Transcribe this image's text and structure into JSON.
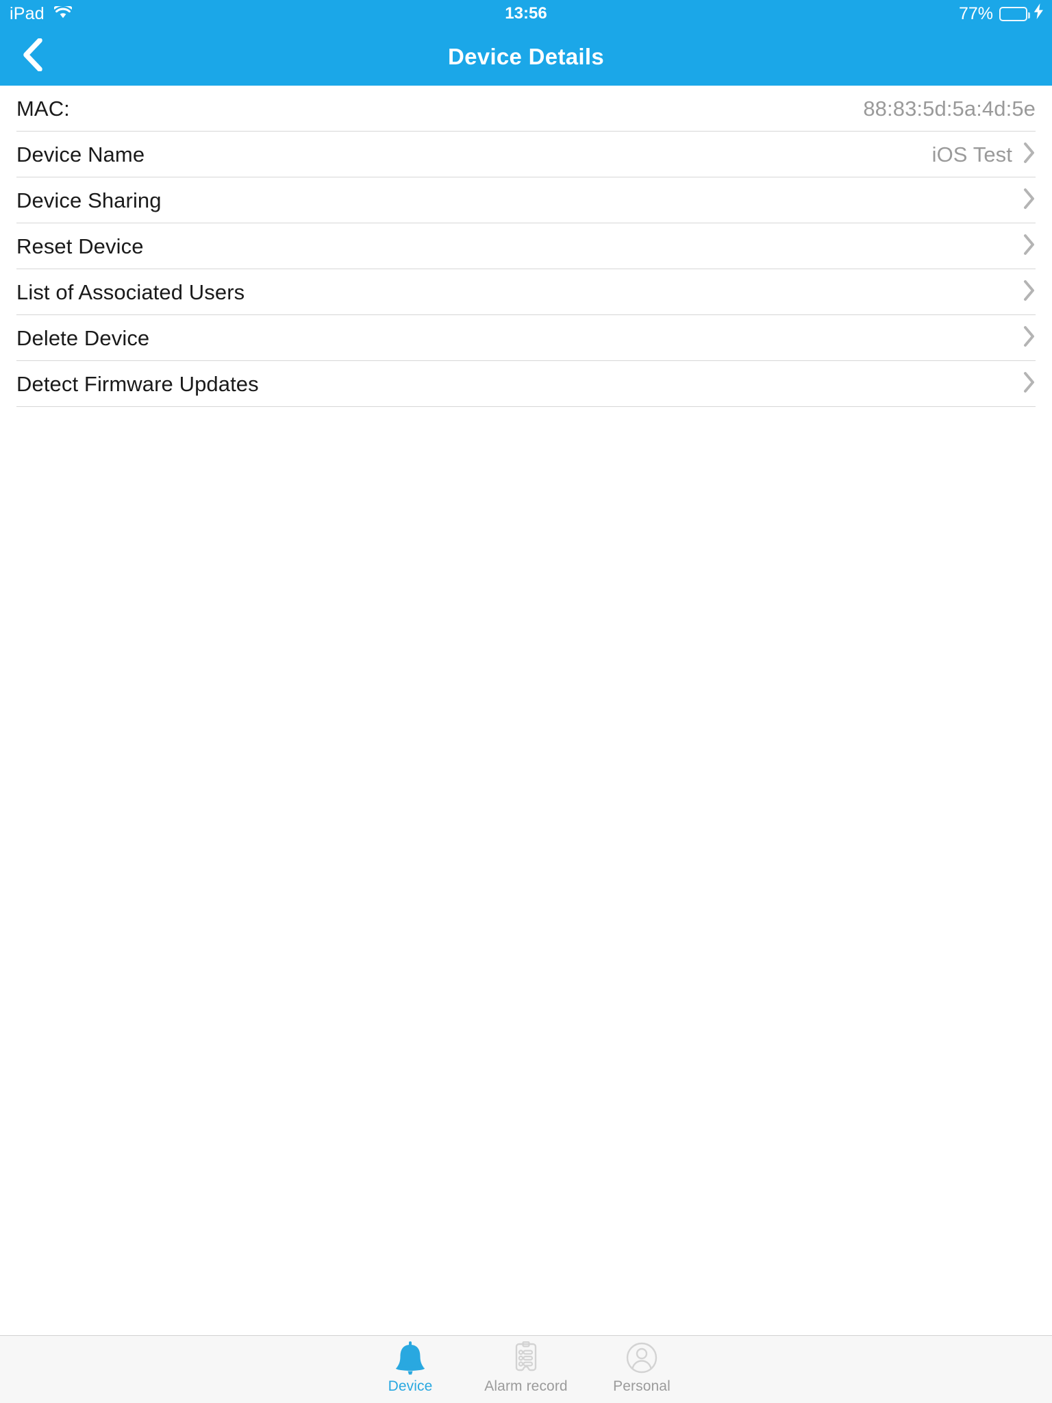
{
  "status_bar": {
    "device_label": "iPad",
    "wifi_icon": "wifi-icon",
    "time": "13:56",
    "battery_percent": "77%",
    "battery_level": 77,
    "battery_icon": "battery-icon",
    "charging_icon": "lightning-bolt-icon"
  },
  "nav": {
    "back_icon": "chevron-left-icon",
    "title": "Device Details"
  },
  "colors": {
    "accent": "#1ba7e8",
    "tab_active": "#29a8e0",
    "tab_inactive": "#9b9b9b",
    "value_text": "#9a9a9a",
    "battery_green": "#4cd964"
  },
  "list": {
    "rows": [
      {
        "label": "MAC:",
        "value": "88:83:5d:5a:4d:5e",
        "chevron": false,
        "name": "mac"
      },
      {
        "label": "Device Name",
        "value": "iOS Test",
        "chevron": true,
        "name": "device-name"
      },
      {
        "label": "Device Sharing",
        "value": "",
        "chevron": true,
        "name": "device-sharing"
      },
      {
        "label": "Reset Device",
        "value": "",
        "chevron": true,
        "name": "reset-device"
      },
      {
        "label": "List of Associated Users",
        "value": "",
        "chevron": true,
        "name": "list-of-associated-users"
      },
      {
        "label": "Delete Device",
        "value": "",
        "chevron": true,
        "name": "delete-device"
      },
      {
        "label": "Detect Firmware Updates",
        "value": "",
        "chevron": true,
        "name": "detect-firmware-updates"
      }
    ]
  },
  "tab_bar": {
    "tabs": [
      {
        "label": "Device",
        "icon": "bell-icon",
        "active": true
      },
      {
        "label": "Alarm record",
        "icon": "clipboard-list-icon",
        "active": false
      },
      {
        "label": "Personal",
        "icon": "person-circle-icon",
        "active": false
      }
    ]
  }
}
